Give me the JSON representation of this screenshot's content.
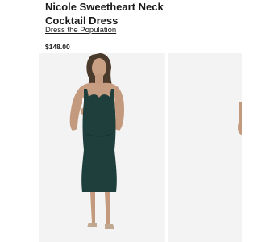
{
  "product": {
    "title": "Nicole Sweetheart Neck Cocktail Dress",
    "brand": "Dress the Population",
    "price": "$148.00"
  },
  "gallery": {
    "images": [
      {
        "icon": "model-in-green-dress-image",
        "dress_color": "#1f3f3d"
      },
      {
        "icon": "model-partial-image",
        "dress_color": "#1f3f3d"
      }
    ]
  },
  "colors": {
    "dress": "#1f3f3d",
    "background": "#f3f3f3",
    "text": "#191a1b"
  }
}
